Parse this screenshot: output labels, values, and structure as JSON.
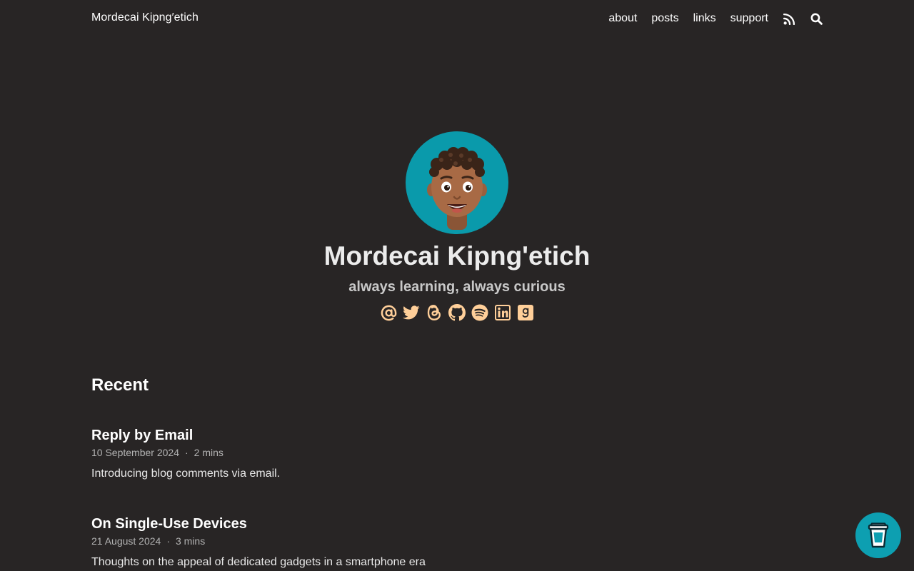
{
  "header": {
    "site_title": "Mordecai Kipng′etich",
    "nav": [
      {
        "label": "about"
      },
      {
        "label": "posts"
      },
      {
        "label": "links"
      },
      {
        "label": "support"
      }
    ],
    "icons": [
      "rss-icon",
      "search-icon"
    ]
  },
  "hero": {
    "name": "Mordecai Kipng'etich",
    "tagline": "always learning, always curious",
    "avatar_bg": "#0a9aab",
    "socials": [
      "email-icon",
      "twitter-icon",
      "threads-icon",
      "github-icon",
      "spotify-icon",
      "linkedin-icon",
      "goodreads-icon"
    ],
    "social_color": "#ffcf99"
  },
  "recent": {
    "heading": "Recent",
    "posts": [
      {
        "title": "Reply by Email",
        "date": "10 September 2024",
        "read_time": "2 mins",
        "summary": "Introducing blog comments via email."
      },
      {
        "title": "On Single-Use Devices",
        "date": "21 August 2024",
        "read_time": "3 mins",
        "summary": "Thoughts on the appeal of dedicated gadgets in a smartphone era"
      }
    ]
  },
  "colors": {
    "background": "#282525",
    "accent": "#ffcf99",
    "bmc_button": "#0d9fb1"
  }
}
